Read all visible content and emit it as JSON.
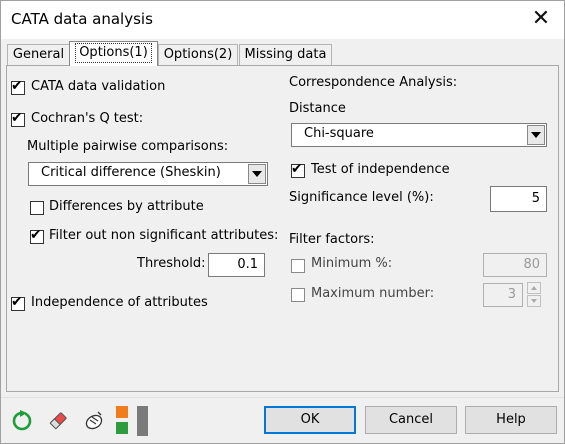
{
  "window": {
    "title": "CATA data analysis",
    "close_glyph": "✕"
  },
  "tabs": [
    {
      "label": "General"
    },
    {
      "label": "Options(1)"
    },
    {
      "label": "Options(2)"
    },
    {
      "label": "Missing data"
    }
  ],
  "left": {
    "cata_validation": {
      "label": "CATA data validation",
      "checked": true
    },
    "cochran": {
      "label": "Cochran's Q test:",
      "checked": true
    },
    "pairwise_label": "Multiple pairwise comparisons:",
    "pairwise_value": "Critical difference (Sheskin)",
    "diff_by_attr": {
      "label": "Differences by attribute",
      "checked": false
    },
    "filter_non_sig": {
      "label": "Filter out non significant attributes:",
      "checked": true
    },
    "threshold_label": "Threshold:",
    "threshold_value": "0.1",
    "independence": {
      "label": "Independence of attributes",
      "checked": true
    }
  },
  "right": {
    "ca_title": "Correspondence Analysis:",
    "distance_label": "Distance",
    "distance_value": "Chi-square",
    "test_indep": {
      "label": "Test of independence",
      "checked": true
    },
    "sig_label": "Significance level (%):",
    "sig_value": "5",
    "filter_factors_label": "Filter factors:",
    "minimum": {
      "label": "Minimum %:",
      "checked": false,
      "value": "80"
    },
    "maximum": {
      "label": "Maximum number:",
      "checked": false,
      "value": "3"
    }
  },
  "buttons": {
    "ok": "OK",
    "cancel": "Cancel",
    "help": "Help"
  },
  "toolbar_icons": [
    "reset-icon",
    "eraser-icon",
    "load-icon",
    "options-toggle-icon",
    "collapse-icon"
  ],
  "colors": {
    "accent": "#0078d7",
    "reset_green": "#1e9e3a",
    "toggle_orange": "#f07c1e",
    "toggle_green": "#2e9b3f"
  },
  "checkmark": "✔"
}
